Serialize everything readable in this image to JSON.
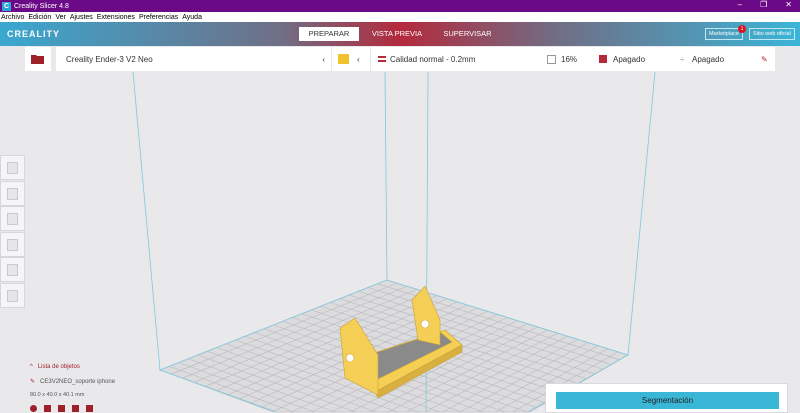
{
  "window": {
    "title": "Creality Slicer 4.8",
    "minimize": "–",
    "restore": "❐",
    "close": "✕",
    "logo": "C"
  },
  "menu": [
    "Archivo",
    "Edición",
    "Ver",
    "Ajustes",
    "Extensiones",
    "Preferencias",
    "Ayuda"
  ],
  "header": {
    "brand": "CREALITY",
    "tabs": [
      "PREPARAR",
      "VISTA PREVIA",
      "SUPERVISAR"
    ],
    "marketplace": "Marketplace",
    "marketplace_badge": "1",
    "website": "Sitio web oficial"
  },
  "printer": {
    "name": "Creality Ender-3 V2 Neo",
    "chevron": "‹"
  },
  "settings": {
    "profile": "Calidad normal - 0.2mm",
    "infill": "16%",
    "support": "Apagado",
    "adhesion": "Apagado"
  },
  "objects": {
    "header": "Lista de objetos",
    "name": "CE3V2NEO_soporte iphone",
    "dimensions": "80.0 x 40.0 x 40.1 mm"
  },
  "action": {
    "slice": "Segmentación"
  },
  "colors": {
    "accent": "#3ab6d6",
    "brand_red": "#b42a3d",
    "title_purple": "#6b0a86",
    "model": "#f5cf55"
  }
}
